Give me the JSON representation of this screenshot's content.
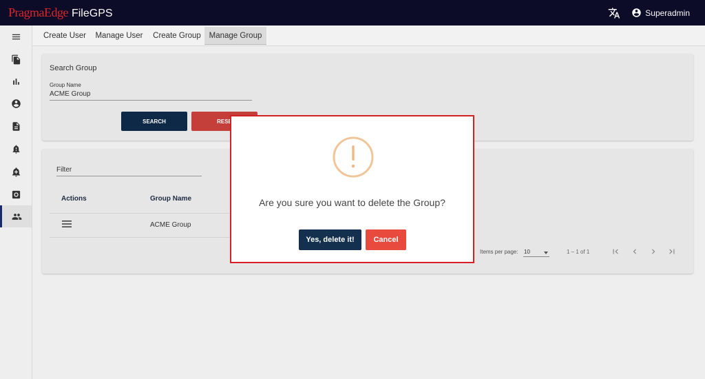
{
  "app": {
    "brand_primary": "PragmaEdge",
    "brand_secondary": "FileGPS"
  },
  "header": {
    "user_name": "Superadmin"
  },
  "sidebar": {
    "items": [
      {
        "icon": "menu-icon"
      },
      {
        "icon": "files-icon"
      },
      {
        "icon": "bar-chart-icon"
      },
      {
        "icon": "account-icon"
      },
      {
        "icon": "document-icon"
      },
      {
        "icon": "alert-bell-icon"
      },
      {
        "icon": "add-alert-icon"
      },
      {
        "icon": "support-icon"
      },
      {
        "icon": "group-icon",
        "active": true
      }
    ]
  },
  "tabs": [
    {
      "label": "Create User"
    },
    {
      "label": "Manage User"
    },
    {
      "label": "Create Group"
    },
    {
      "label": "Manage Group",
      "active": true
    }
  ],
  "search": {
    "title": "Search Group",
    "group_name_label": "Group Name",
    "group_name_value": "ACME Group",
    "search_button": "SEARCH",
    "reset_button": "RESE"
  },
  "table": {
    "filter_label": "Filter",
    "columns": [
      "Actions",
      "Group Name"
    ],
    "rows": [
      {
        "group_name": "ACME Group"
      }
    ],
    "items_per_page_label": "Items per page:",
    "items_per_page_value": "10",
    "range": "1 – 1 of 1"
  },
  "dialog": {
    "message": "Are you sure you want to delete the Group?",
    "confirm_label": "Yes, delete it!",
    "cancel_label": "Cancel"
  },
  "colors": {
    "topbar": "#0d0d2a",
    "brand_red": "#e0262b",
    "primary_button": "#0f2a4a",
    "danger_button": "#e84a3e",
    "warning": "#f1c59a",
    "dialog_border": "#d81f26"
  }
}
